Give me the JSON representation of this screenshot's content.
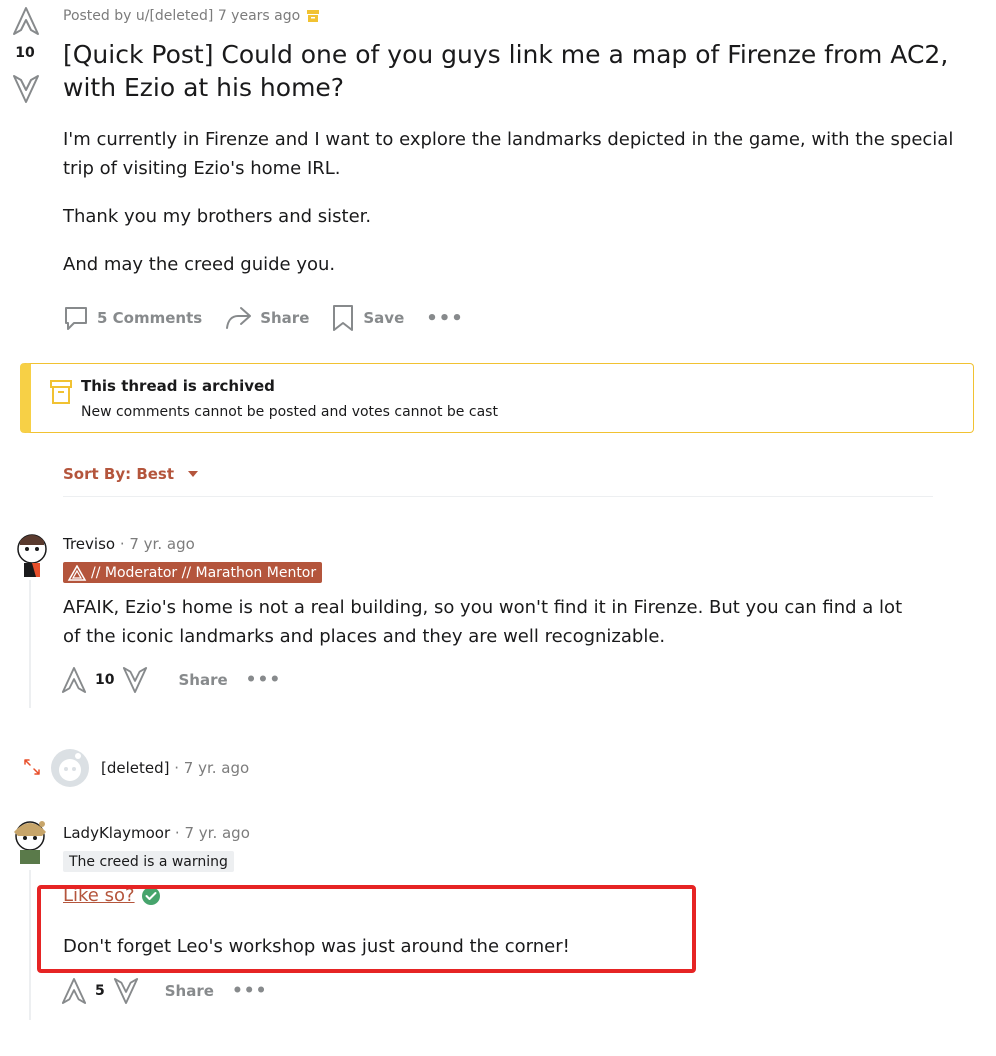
{
  "post": {
    "meta": "Posted by u/[deleted] 7 years ago",
    "score": "10",
    "title": "[Quick Post] Could one of you guys link me a map of Firenze from AC2, with Ezio at his home?",
    "body": [
      "I'm currently in Firenze and I want to explore the landmarks depicted in the game, with the special trip of visiting Ezio's home IRL.",
      "Thank you my brothers and sister.",
      "And may the creed guide you."
    ],
    "actions": {
      "comments": "5 Comments",
      "share": "Share",
      "save": "Save"
    }
  },
  "archive_banner": {
    "title": "This thread is archived",
    "subtitle": "New comments cannot be posted and votes cannot be cast"
  },
  "sort": {
    "label": "Sort By: Best"
  },
  "comments": [
    {
      "user": "Treviso",
      "time": " · 7 yr. ago",
      "flair": "// Moderator // Marathon Mentor",
      "text": "AFAIK, Ezio's home is not a real building, so you won't find it in Firenze. But you can find a lot of the iconic landmarks and places and they are well recognizable.",
      "score": "10",
      "share": "Share"
    },
    {
      "user": "[deleted]",
      "time": " · 7 yr. ago"
    },
    {
      "user": "LadyKlaymoor",
      "time": " · 7 yr. ago",
      "flair": "The creed is a warning",
      "link_text": "Like so?",
      "text": "Don't forget Leo's workshop was just around the corner!",
      "score": "5",
      "share": "Share"
    }
  ],
  "colors": {
    "accent": "#b4553c",
    "archive_yellow": "#f7d046",
    "highlight_red": "#e62424",
    "verified_green": "#46a46c"
  }
}
